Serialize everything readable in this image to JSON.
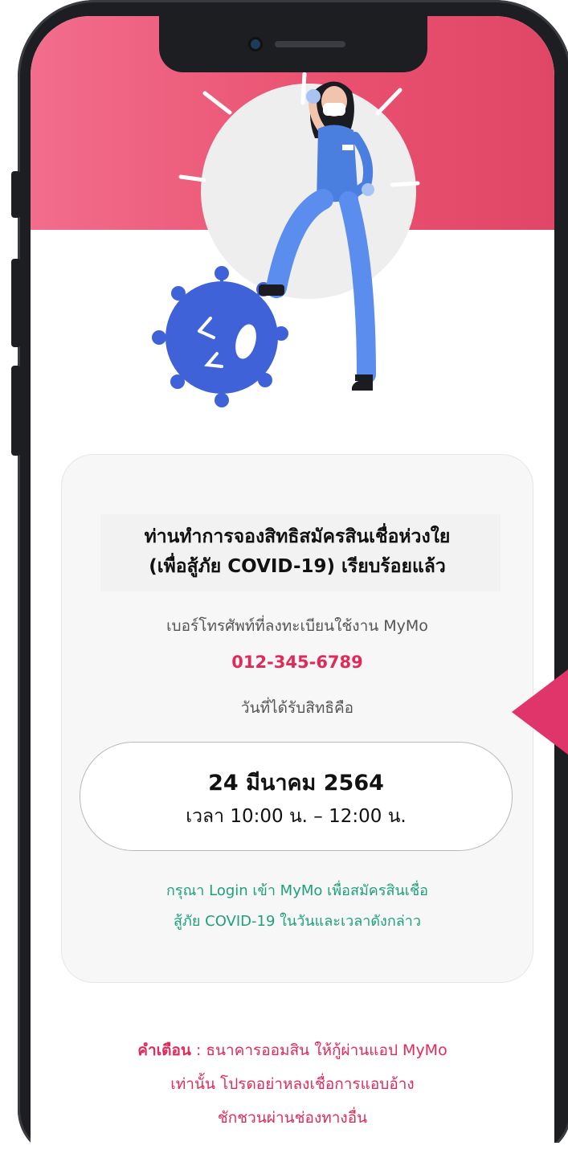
{
  "confirmation": {
    "title_line1": "ท่านทำการจองสิทธิสมัครสินเชื่อห่วงใย",
    "title_line2": "(เพื่อสู้ภัย COVID-19) เรียบร้อยแล้ว",
    "phone_label": "เบอร์โทรศัพท์ที่ลงทะเบียนใช้งาน MyMo",
    "phone_number": "012-345-6789",
    "date_label": "วันที่ได้รับสิทธิคือ",
    "date_value": "24 มีนาคม 2564",
    "time_value": "เวลา 10:00 น. – 12:00 น.",
    "login_note_line1": "กรุณา Login เข้า MyMo เพื่อสมัครสินเชื่อ",
    "login_note_line2": "สู้ภัย COVID-19 ในวันและเวลาดังกล่าว"
  },
  "warning": {
    "label": "คำเตือน",
    "text_line1": " : ธนาคารออมสิน ให้กู้ผ่านแอป MyMo",
    "text_line2": "เท่านั้น โปรดอย่าหลงเชื่อการแอบอ้าง",
    "text_line3": "ชักชวนผ่านช่องทางอื่น"
  },
  "colors": {
    "brand_pink": "#e9506f",
    "phone_number": "#e02b5a",
    "note_green": "#1fa07a",
    "nurse_blue": "#4a7fe0",
    "virus_blue": "#3f62d8"
  },
  "icons": [
    "nurse-illustration",
    "virus-illustration"
  ]
}
